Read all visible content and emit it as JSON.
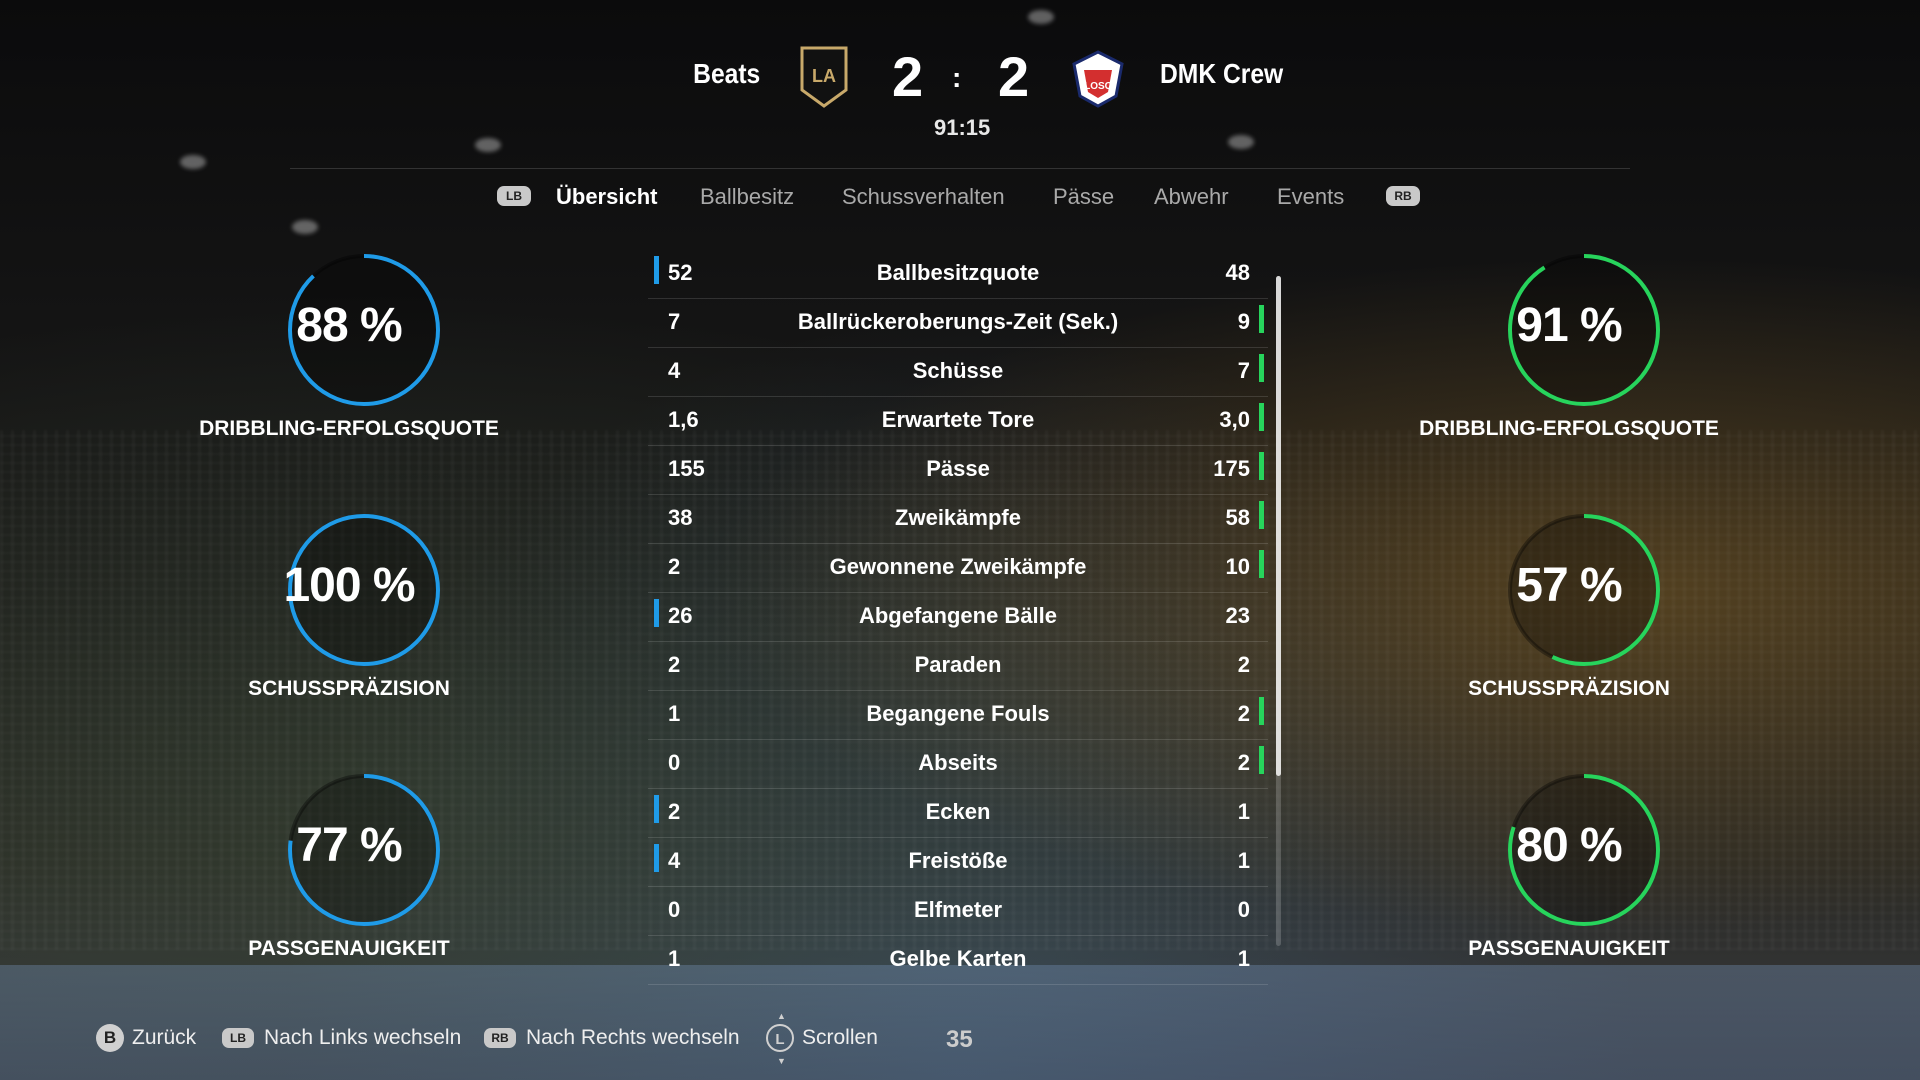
{
  "match": {
    "home_team": "Beats",
    "away_team": "DMK Crew",
    "home_score": "2",
    "away_score": "2",
    "separator": ":",
    "time": "91:15",
    "home_crest": "lafc-crest-icon",
    "away_crest": "losc-crest-icon",
    "home_crest_text": "LA",
    "away_crest_text": "LOSC"
  },
  "tabs": {
    "left_bumper": "LB",
    "right_bumper": "RB",
    "items": [
      "Übersicht",
      "Ballbesitz",
      "Schussverhalten",
      "Pässe",
      "Abwehr",
      "Events"
    ],
    "active": "Übersicht"
  },
  "home_rings": [
    {
      "value": "88 %",
      "percent": 88,
      "label": "DRIBBLING-ERFOLGSQUOTE"
    },
    {
      "value": "100 %",
      "percent": 100,
      "label": "SCHUSSPRÄZISION"
    },
    {
      "value": "77 %",
      "percent": 77,
      "label": "PASSGENAUIGKEIT"
    }
  ],
  "away_rings": [
    {
      "value": "91 %",
      "percent": 91,
      "label": "DRIBBLING-ERFOLGSQUOTE"
    },
    {
      "value": "57 %",
      "percent": 57,
      "label": "SCHUSSPRÄZISION"
    },
    {
      "value": "80 %",
      "percent": 80,
      "label": "PASSGENAUIGKEIT"
    }
  ],
  "stats": [
    {
      "name": "Ballbesitzquote",
      "home": "52",
      "away": "48",
      "leader": "home"
    },
    {
      "name": "Ballrückeroberungs-Zeit (Sek.)",
      "home": "7",
      "away": "9",
      "leader": "away"
    },
    {
      "name": "Schüsse",
      "home": "4",
      "away": "7",
      "leader": "away"
    },
    {
      "name": "Erwartete Tore",
      "home": "1,6",
      "away": "3,0",
      "leader": "away"
    },
    {
      "name": "Pässe",
      "home": "155",
      "away": "175",
      "leader": "away"
    },
    {
      "name": "Zweikämpfe",
      "home": "38",
      "away": "58",
      "leader": "away"
    },
    {
      "name": "Gewonnene Zweikämpfe",
      "home": "2",
      "away": "10",
      "leader": "away"
    },
    {
      "name": "Abgefangene Bälle",
      "home": "26",
      "away": "23",
      "leader": "home"
    },
    {
      "name": "Paraden",
      "home": "2",
      "away": "2",
      "leader": "none"
    },
    {
      "name": "Begangene Fouls",
      "home": "1",
      "away": "2",
      "leader": "away"
    },
    {
      "name": "Abseits",
      "home": "0",
      "away": "2",
      "leader": "away"
    },
    {
      "name": "Ecken",
      "home": "2",
      "away": "1",
      "leader": "home"
    },
    {
      "name": "Freistöße",
      "home": "4",
      "away": "1",
      "leader": "home"
    },
    {
      "name": "Elfmeter",
      "home": "0",
      "away": "0",
      "leader": "none"
    },
    {
      "name": "Gelbe Karten",
      "home": "1",
      "away": "1",
      "leader": "none"
    }
  ],
  "footer": {
    "back_key": "B",
    "back_label": "Zurück",
    "left_key": "LB",
    "left_label": "Nach Links wechseln",
    "right_key": "RB",
    "right_label": "Nach Rechts wechseln",
    "scroll_key": "L",
    "scroll_label": "Scrollen",
    "page_number": "35"
  },
  "colors": {
    "home_accent": "#1f9be8",
    "away_accent": "#27d45c",
    "ring_track": "rgba(0,0,0,0.35)"
  }
}
